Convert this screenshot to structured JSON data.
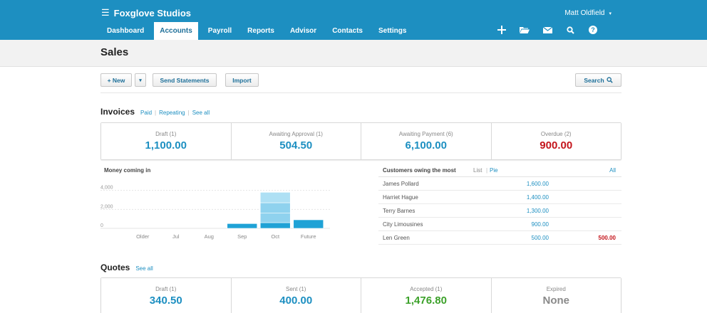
{
  "brand": {
    "name": "Foxglove Studios",
    "menu_icon": "list-menu-icon"
  },
  "user": {
    "name": "Matt Oldfield",
    "caret": "▾"
  },
  "nav": {
    "tabs": [
      {
        "label": "Dashboard"
      },
      {
        "label": "Accounts"
      },
      {
        "label": "Payroll"
      },
      {
        "label": "Reports"
      },
      {
        "label": "Advisor"
      },
      {
        "label": "Contacts"
      },
      {
        "label": "Settings"
      }
    ],
    "active_tab": "Accounts",
    "icons": [
      "plus-icon",
      "folder-icon",
      "mail-icon",
      "search-icon",
      "help-icon"
    ]
  },
  "page": {
    "title": "Sales"
  },
  "toolbar": {
    "new_label": "+ New",
    "new_dropdown": "▾",
    "send_label": "Send Statements",
    "import_label": "Import",
    "search_label": "Search"
  },
  "invoices": {
    "title": "Invoices",
    "links": [
      "Paid",
      "Repeating",
      "See all"
    ],
    "summary": [
      {
        "label": "Draft (1)",
        "value": "1,100.00",
        "color": "#1d8fc1"
      },
      {
        "label": "Awaiting Approval (1)",
        "value": "504.50",
        "color": "#1d8fc1"
      },
      {
        "label": "Awaiting Payment (6)",
        "value": "6,100.00",
        "color": "#1d8fc1"
      },
      {
        "label": "Overdue (2)",
        "value": "900.00",
        "color": "#c4151c"
      }
    ]
  },
  "money_in": {
    "title": "Money coming in",
    "chart_data": {
      "type": "bar",
      "categories": [
        "Older",
        "Jul",
        "Aug",
        "Sep",
        "Oct",
        "Future"
      ],
      "stacked_segments": [
        [],
        [],
        [],
        [
          500
        ],
        [
          600,
          1000,
          1100,
          1100
        ],
        [
          900
        ]
      ],
      "yticks": [
        "0",
        "2,000",
        "4,000"
      ],
      "ylim": [
        0,
        4800
      ],
      "colors": {
        "base": "#1fa2d6",
        "light": "#8fd2ee",
        "lighter": "#aee0f4"
      }
    }
  },
  "owing": {
    "title": "Customers owing the most",
    "options": [
      "List",
      "Pie"
    ],
    "all_label": "All",
    "rows": [
      {
        "name": "James Pollard",
        "amount": "1,600.00",
        "overdue": ""
      },
      {
        "name": "Harriet Hague",
        "amount": "1,400.00",
        "overdue": ""
      },
      {
        "name": "Terry Barnes",
        "amount": "1,300.00",
        "overdue": ""
      },
      {
        "name": "City Limousines",
        "amount": "900.00",
        "overdue": ""
      },
      {
        "name": "Len Green",
        "amount": "500.00",
        "overdue": "500.00"
      }
    ]
  },
  "quotes": {
    "title": "Quotes",
    "links": [
      "See all"
    ],
    "summary": [
      {
        "label": "Draft (1)",
        "value": "340.50",
        "color": "#1d8fc1"
      },
      {
        "label": "Sent (1)",
        "value": "400.00",
        "color": "#1d8fc1"
      },
      {
        "label": "Accepted (1)",
        "value": "1,476.80",
        "color": "#3ca12a"
      },
      {
        "label": "Expired",
        "value": "None",
        "color": "#8a8a8a"
      }
    ]
  }
}
